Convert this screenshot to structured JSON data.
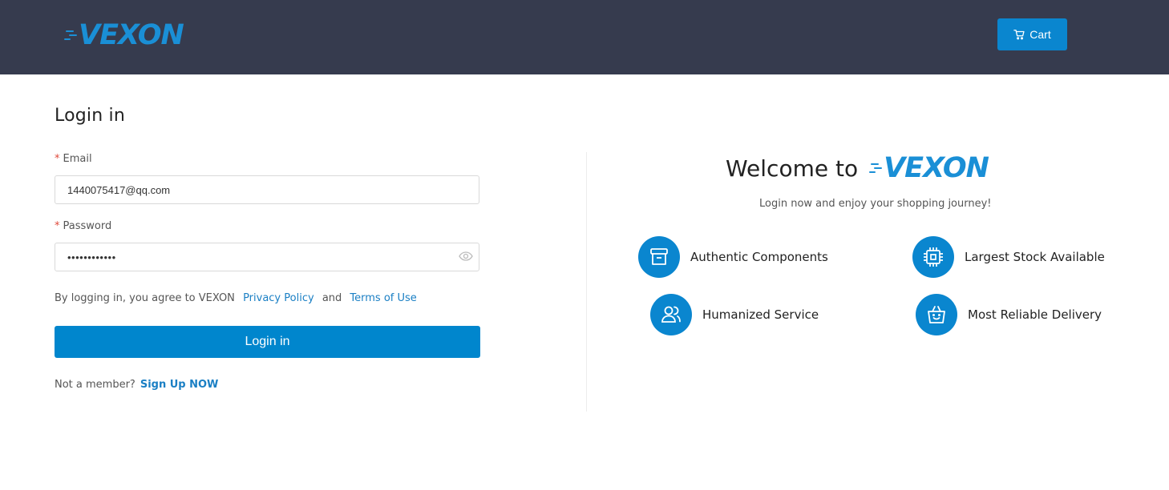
{
  "header": {
    "logo_text": "VEXON",
    "cart_label": "Cart"
  },
  "form": {
    "title": "Login in",
    "email_label": "Email",
    "email_value": "1440075417@qq.com",
    "password_label": "Password",
    "password_value": "••••••••••••",
    "agree_prefix": "By logging in, you agree to VEXON",
    "privacy_link": "Privacy Policy",
    "and_text": "and",
    "terms_link": "Terms of Use",
    "login_button": "Login in",
    "not_member": "Not a member?",
    "signup_link": "Sign Up NOW",
    "required_mark": "*"
  },
  "welcome": {
    "heading": "Welcome to",
    "logo_text": "VEXON",
    "tagline": "Login now and enjoy your shopping journey!"
  },
  "features": [
    {
      "label": "Authentic Components",
      "icon": "archive-box-icon"
    },
    {
      "label": "Largest Stock Available",
      "icon": "chip-icon"
    },
    {
      "label": "Humanized Service",
      "icon": "users-icon"
    },
    {
      "label": "Most Reliable Delivery",
      "icon": "shopping-bag-icon"
    }
  ],
  "colors": {
    "header_bg": "#363b4e",
    "brand_blue": "#1a8fd6",
    "button_blue": "#0086cd",
    "link_blue": "#1a7fc4",
    "required_red": "#e0493b"
  }
}
